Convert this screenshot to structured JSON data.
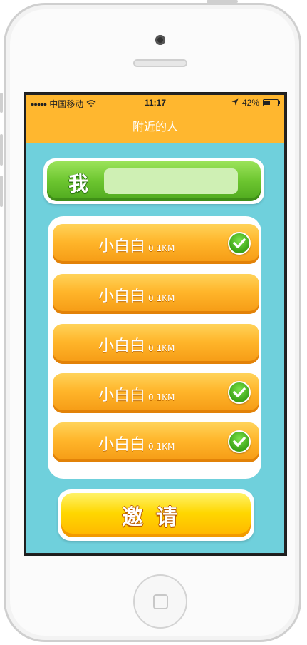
{
  "statusbar": {
    "signal_dots": "●●●●●",
    "carrier": "中国移动",
    "wifi_icon": "wifi-icon",
    "time": "11:17",
    "location_icon": "location-arrow-icon",
    "battery_text": "42%",
    "battery_level": 0.42
  },
  "header": {
    "title": "附近的人"
  },
  "me": {
    "label": "我",
    "input_value": ""
  },
  "people": [
    {
      "name": "小白白",
      "distance": "0.1KM",
      "checked": true
    },
    {
      "name": "小白白",
      "distance": "0.1KM",
      "checked": false
    },
    {
      "name": "小白白",
      "distance": "0.1KM",
      "checked": false
    },
    {
      "name": "小白白",
      "distance": "0.1KM",
      "checked": true
    },
    {
      "name": "小白白",
      "distance": "0.1KM",
      "checked": true
    }
  ],
  "invite": {
    "label": "邀请"
  },
  "colors": {
    "accent_orange": "#ffb72f",
    "background_teal": "#6fd0dc",
    "green_button": "#6cc52f",
    "yellow_button": "#ffd700"
  }
}
